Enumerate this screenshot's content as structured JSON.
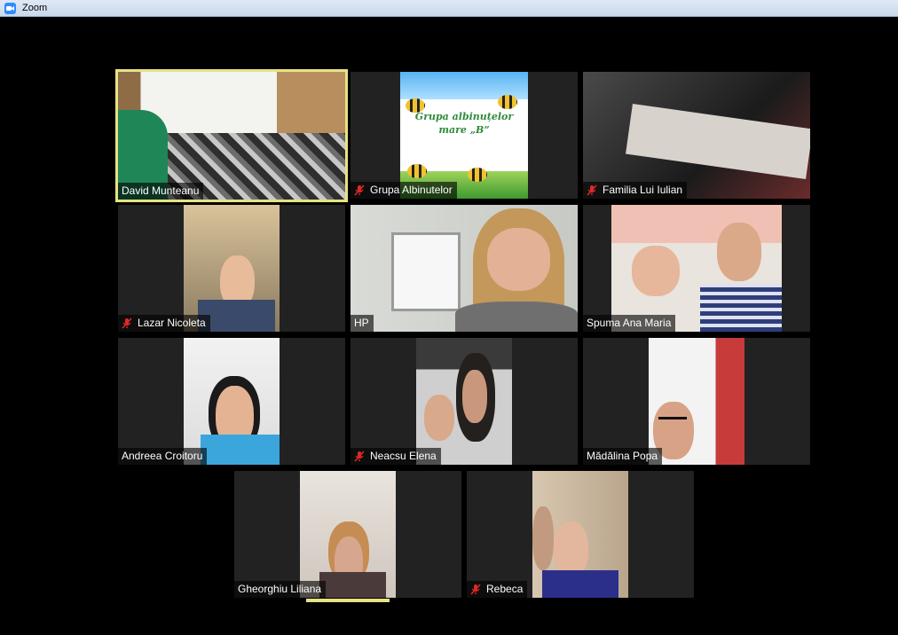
{
  "window": {
    "title": "Zoom",
    "icon": "zoom-camera-icon"
  },
  "colors": {
    "active_border": "#e6e285",
    "tile_bg": "#222222",
    "muted_icon": "#e02828"
  },
  "bee_slide": {
    "line1": "Grupa albinuțelor",
    "line2": "mare „B”"
  },
  "participants": [
    {
      "name": "David Munteanu",
      "muted": false,
      "active_speaker": true
    },
    {
      "name": "Grupa Albinutelor",
      "muted": true
    },
    {
      "name": "Familia Lui Iulian",
      "muted": true
    },
    {
      "name": "Lazar Nicoleta",
      "muted": true
    },
    {
      "name": "HP",
      "muted": false
    },
    {
      "name": "Spuma Ana Maria",
      "muted": false
    },
    {
      "name": "Andreea Croitoru",
      "muted": false
    },
    {
      "name": "Neacsu Elena",
      "muted": true
    },
    {
      "name": "Mădălina Popa",
      "muted": false
    },
    {
      "name": "Gheorghiu Liliana",
      "muted": false
    },
    {
      "name": "Rebeca",
      "muted": true
    }
  ]
}
